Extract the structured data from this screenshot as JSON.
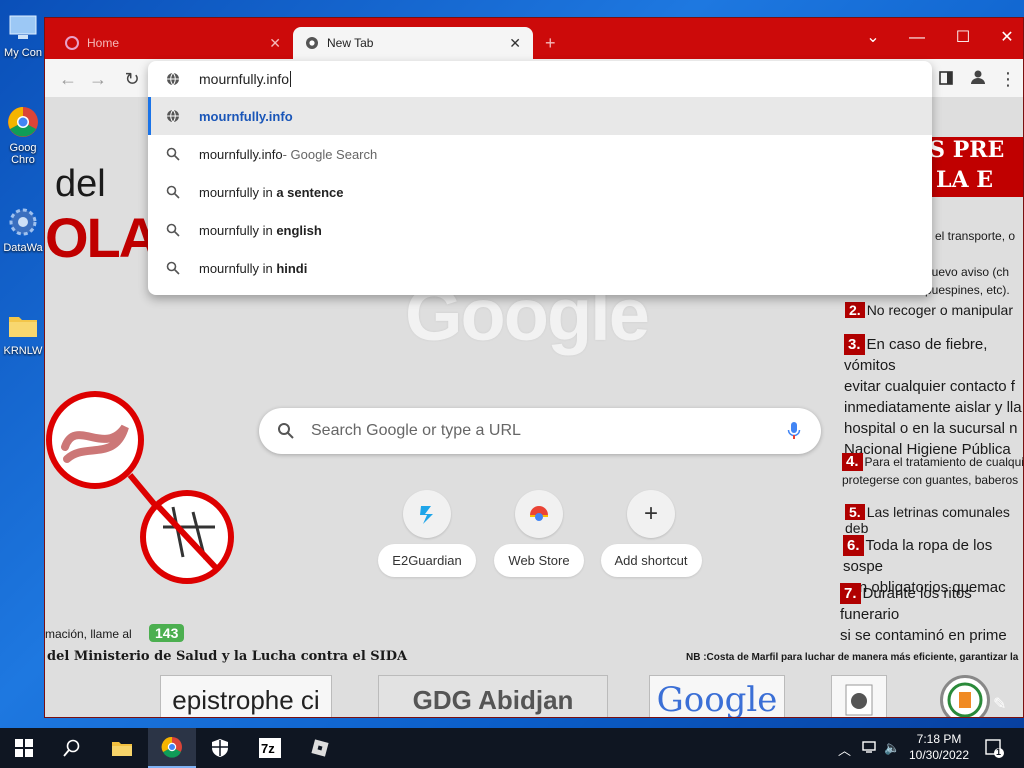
{
  "desktop": {
    "icons": [
      {
        "label": "My Con"
      },
      {
        "label": "Goog\nChro"
      },
      {
        "label": "DataWa"
      },
      {
        "label": "KRNLW"
      }
    ]
  },
  "browser": {
    "tabs": [
      {
        "title": "Home"
      },
      {
        "title": "New Tab"
      }
    ],
    "omnibox": {
      "input_value": "mournfully.info",
      "suggestions": [
        {
          "icon": "globe-icon",
          "text": "mournfully.info",
          "suffix": ""
        },
        {
          "icon": "search-icon",
          "text": "mournfully.info",
          "suffix": " - Google Search"
        },
        {
          "icon": "search-icon",
          "text": "mournfully in ",
          "bold": "a sentence"
        },
        {
          "icon": "search-icon",
          "text": "mournfully in ",
          "bold": "english"
        },
        {
          "icon": "search-icon",
          "text": "mournfully in ",
          "bold": "hindi"
        }
      ]
    },
    "new_tab": {
      "search_placeholder": "Search Google or type a URL",
      "shortcuts": [
        {
          "label": "E2Guardian"
        },
        {
          "label": "Web Store"
        },
        {
          "label": "Add shortcut"
        }
      ]
    },
    "background": {
      "left_title_1": "del",
      "left_title_2": "OLA",
      "phone_text": "mación, llame al",
      "phone_badge": "143",
      "ministry": "del Ministerio de Salud y la Lucha contra el SIDA",
      "nb_text": "NB :Costa de Marfil para luchar de manera más eficiente, garantizar la",
      "band_1": "DAS PRE",
      "band_2": "RA LA E",
      "item0_l1": "o el transporte, o d",
      "item0_l2": "nuevo aviso (ch",
      "item0_l3": "puespines, etc).",
      "item2": "No recoger o manipular",
      "item3_l1": "En caso de fiebre, vómitos",
      "item3_l2": "evitar cualquier contacto f",
      "item3_l3": "inmediatamente aislar y lla",
      "item3_l4": "hospital o en la sucursal n",
      "item3_l5": "Nacional Higiene Pública",
      "item4_l1": "Para el tratamiento de cualqui",
      "item4_l2": "protegerse con guantes, baberos",
      "item5": "Las letrinas comunales deb",
      "item6_l1": "Toda la ropa de los sospe",
      "item6_l2": "son obligatorios quemac",
      "item7_l1": "Durante los ritos funerario",
      "item7_l2": "si se contaminó en prime",
      "n2": "2.",
      "n3": "3.",
      "n4": "4.",
      "n5": "5.",
      "n6": "6.",
      "n7": "7.",
      "logos": [
        "epistrophe ci",
        "GDG Abidjan",
        "Google"
      ]
    }
  },
  "taskbar": {
    "time": "7:18 PM",
    "date": "10/30/2022",
    "notification_count": "1"
  },
  "colors": {
    "titlebar": "#cc0a0a",
    "accent_blue": "#1a73e8",
    "taskbar": "#0f1622"
  }
}
